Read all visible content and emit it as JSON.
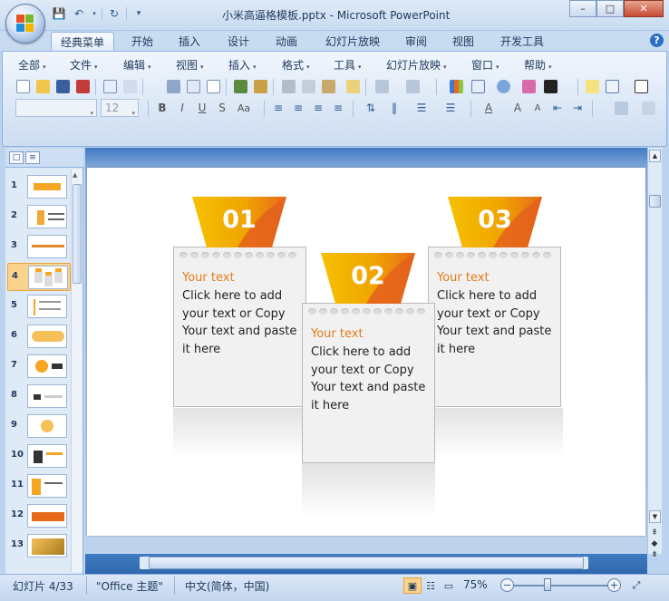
{
  "window": {
    "title": "小米高逼格模板.pptx - Microsoft PowerPoint",
    "controls": [
      "minimize",
      "maximize",
      "close"
    ]
  },
  "quick_access": [
    "save-icon",
    "undo-icon",
    "redo-icon",
    "customize-dropdown-icon"
  ],
  "ribbon_tabs": [
    {
      "label": "经典菜单",
      "active": true
    },
    {
      "label": "开始"
    },
    {
      "label": "插入"
    },
    {
      "label": "设计"
    },
    {
      "label": "动画"
    },
    {
      "label": "幻灯片放映"
    },
    {
      "label": "审阅"
    },
    {
      "label": "视图"
    },
    {
      "label": "开发工具"
    }
  ],
  "menu": [
    {
      "label": "全部"
    },
    {
      "label": "文件"
    },
    {
      "label": "编辑"
    },
    {
      "label": "视图"
    },
    {
      "label": "插入"
    },
    {
      "label": "格式"
    },
    {
      "label": "工具"
    },
    {
      "label": "幻灯片放映"
    },
    {
      "label": "窗口"
    },
    {
      "label": "帮助"
    }
  ],
  "font_size_value": "12",
  "thumbnails": [
    "1",
    "2",
    "3",
    "4",
    "5",
    "6",
    "7",
    "8",
    "9",
    "10",
    "11",
    "12",
    "13"
  ],
  "selected_slide": "4",
  "slide": {
    "cards": [
      {
        "number": "01",
        "heading": "Your text",
        "body": "Click here to add your text or Copy Your text and paste it here"
      },
      {
        "number": "02",
        "heading": "Your text",
        "body": "Click here to add your text or Copy Your text and paste it here"
      },
      {
        "number": "03",
        "heading": "Your text",
        "body": "Click here to add your text or Copy Your text and paste it here"
      }
    ]
  },
  "status": {
    "slide_info": "幻灯片 4/33",
    "theme": "\"Office 主题\"",
    "language": "中文(简体，中国)",
    "zoom": "75%",
    "zoom_percent": 75
  },
  "colors": {
    "accent_orange": "#e07d1a",
    "badge_yellow": "#f5b800",
    "badge_orange": "#e8681a",
    "ribbon_blue": "#dbe7f6"
  }
}
